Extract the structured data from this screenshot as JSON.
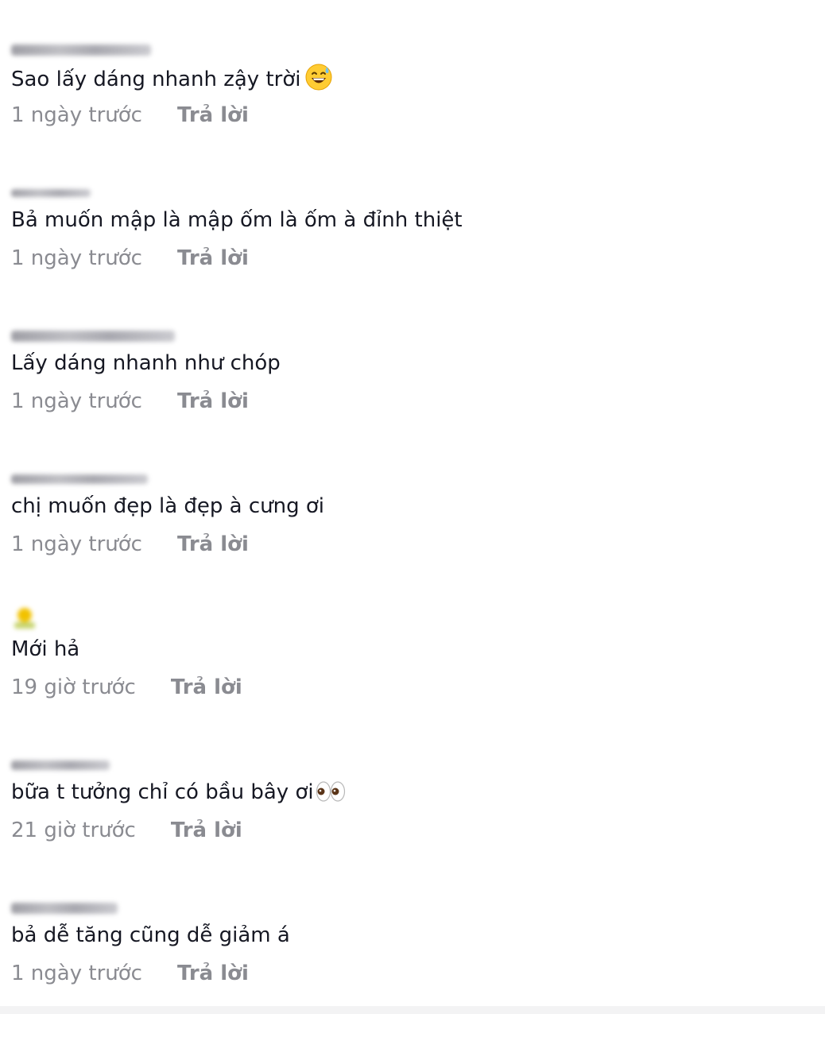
{
  "comments": [
    {
      "text": "Sao lấy dáng nhanh zậy trời",
      "emoji_icon": "grinning-sweat-emoji",
      "time": "1 ngày trước",
      "reply_label": "Trả lời"
    },
    {
      "text": "Bả muốn mập là mập ốm là ốm à đỉnh thiệt",
      "time": "1 ngày trước",
      "reply_label": "Trả lời"
    },
    {
      "text": "Lấy dáng nhanh như chóp",
      "time": "1 ngày trước",
      "reply_label": "Trả lời"
    },
    {
      "text": "chị muốn đẹp là đẹp à cưng ơi",
      "time": "1 ngày trước",
      "reply_label": "Trả lời"
    },
    {
      "text": "Mới hả",
      "time": "19 giờ trước",
      "reply_label": "Trả lời"
    },
    {
      "text": "bữa t tưởng chỉ có bầu bây ơi",
      "emoji_icon": "eyes-emoji",
      "time": "21 giờ trước",
      "reply_label": "Trả lời"
    },
    {
      "text": "bả dễ tăng cũng dễ giảm á",
      "time": "1 ngày trước",
      "reply_label": "Trả lời"
    }
  ]
}
